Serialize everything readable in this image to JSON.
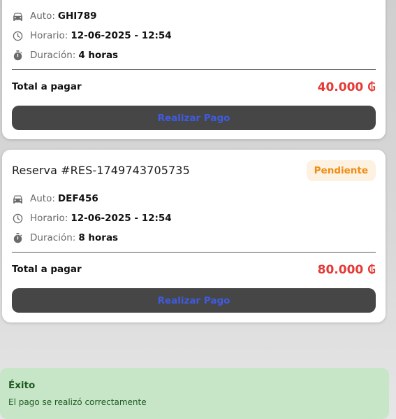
{
  "reservations": [
    {
      "car_label": "Auto:",
      "car": "GHI789",
      "schedule_label": "Horario:",
      "schedule": "12-06-2025 - 12:54",
      "duration_label": "Duración:",
      "duration": "4 horas",
      "total_label": "Total a pagar",
      "total": "40.000 ₲",
      "pay_button": "Realizar Pago"
    },
    {
      "title": "Reserva #RES-1749743705735",
      "status": "Pendiente",
      "car_label": "Auto:",
      "car": "DEF456",
      "schedule_label": "Horario:",
      "schedule": "12-06-2025 - 12:54",
      "duration_label": "Duración:",
      "duration": "8 horas",
      "total_label": "Total a pagar",
      "total": "80.000 ₲",
      "pay_button": "Realizar Pago"
    }
  ],
  "toast": {
    "title": "Éxito",
    "message": "El pago se realizó correctamente"
  },
  "icons": {
    "car": "car-icon",
    "schedule": "clock-icon",
    "duration": "stopwatch-icon"
  },
  "colors": {
    "status_pending_text": "#f08c12",
    "status_pending_bg": "#fdf1e1",
    "total_amount": "#e53935",
    "pay_button_bg": "#464646",
    "pay_button_text": "#3f5be0",
    "toast_bg": "#c7e6c7",
    "toast_text": "#1e5a22"
  }
}
